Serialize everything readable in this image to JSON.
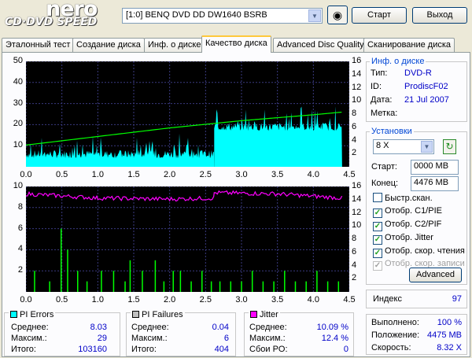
{
  "header": {
    "logo_top": "nero",
    "logo_bottom": "CD·DVD SPEED",
    "drive": "[1:0]   BENQ DVD DD DW1640 BSRB",
    "start_label": "Старт",
    "exit_label": "Выход"
  },
  "tabs": [
    {
      "label": "Эталонный тест"
    },
    {
      "label": "Создание диска"
    },
    {
      "label": "Инф. о диске"
    },
    {
      "label": "Качество диска",
      "active": true
    },
    {
      "label": "Advanced Disc Quality"
    },
    {
      "label": "Сканирование диска"
    }
  ],
  "disc_info": {
    "title": "Инф. о диске",
    "type_label": "Тип:",
    "type_value": "DVD-R",
    "id_label": "ID:",
    "id_value": "ProdiscF02",
    "date_label": "Дата:",
    "date_value": "21 Jul 2007",
    "mark_label": "Метка:",
    "mark_value": ""
  },
  "settings": {
    "title": "Установки",
    "speed": "8 X",
    "start_label": "Старт:",
    "start_value": "0000 MB",
    "end_label": "Конец:",
    "end_value": "4476 MB",
    "checkboxes": [
      {
        "label": "Быстр.скан.",
        "checked": false,
        "disabled": false
      },
      {
        "label": "Отобр. C1/PIE",
        "checked": true,
        "disabled": false
      },
      {
        "label": "Отобр. C2/PIF",
        "checked": true,
        "disabled": false
      },
      {
        "label": "Отобр. Jitter",
        "checked": true,
        "disabled": false
      },
      {
        "label": "Отобр. скор. чтения",
        "checked": true,
        "disabled": false
      },
      {
        "label": "Отобр. скор. записи",
        "checked": true,
        "disabled": true
      }
    ],
    "advanced_label": "Advanced"
  },
  "index": {
    "label": "Индекс",
    "value": "97"
  },
  "progress": {
    "done_label": "Выполнено:",
    "done_value": "100 %",
    "pos_label": "Положение:",
    "pos_value": "4475 MB",
    "speed_label": "Скорость:",
    "speed_value": "8.32 X"
  },
  "stats": {
    "pi_errors": {
      "title": "PI Errors",
      "color": "#00ffff",
      "avg_label": "Среднее:",
      "avg": "8.03",
      "max_label": "Максим.:",
      "max": "29",
      "total_label": "Итого:",
      "total": "103160"
    },
    "pi_failures": {
      "title": "PI Failures",
      "color": "#c0c0c0",
      "avg_label": "Среднее:",
      "avg": "0.04",
      "max_label": "Максим.:",
      "max": "6",
      "total_label": "Итого:",
      "total": "404"
    },
    "jitter": {
      "title": "Jitter",
      "color": "#ff00ff",
      "avg_label": "Среднее:",
      "avg": "10.09 %",
      "max_label": "Максим.:",
      "max": "12.4 %",
      "po_label": "Сбои PO:",
      "po": "0"
    }
  },
  "chart_data": [
    {
      "type": "area",
      "x_ticks": [
        "0.0",
        "0.5",
        "1.0",
        "1.5",
        "2.0",
        "2.5",
        "3.0",
        "3.5",
        "4.0",
        "4.5"
      ],
      "y_left_ticks": [
        "50",
        "40",
        "30",
        "20",
        "10"
      ],
      "y_right_ticks": [
        "16",
        "14",
        "12",
        "10",
        "8",
        "6",
        "4",
        "2"
      ],
      "xlim": [
        0,
        4.5
      ],
      "ylim_left": [
        0,
        50
      ],
      "ylim_right": [
        0,
        16
      ],
      "series": [
        {
          "color": "#00ffff",
          "segments": [
            {
              "x0": 0.0,
              "x1": 2.62,
              "base": 4,
              "spikes": 9
            },
            {
              "x0": 2.62,
              "x1": 4.4,
              "base": 17,
              "spikes": 10
            }
          ]
        },
        {
          "color": "#00ff00",
          "line": [
            [
              0.0,
              3.3
            ],
            [
              1.0,
              4.6
            ],
            [
              2.0,
              5.9
            ],
            [
              3.0,
              7.0
            ],
            [
              4.0,
              7.9
            ],
            [
              4.4,
              8.3
            ]
          ]
        }
      ]
    },
    {
      "type": "bar",
      "x_ticks": [
        "0.0",
        "0.5",
        "1.0",
        "1.5",
        "2.0",
        "2.5",
        "3.0",
        "3.5",
        "4.0",
        "4.5"
      ],
      "y_left_ticks": [
        "10",
        "8",
        "6",
        "4",
        "2"
      ],
      "y_right_ticks": [
        "16",
        "14",
        "12",
        "10",
        "8",
        "6",
        "4",
        "2"
      ],
      "xlim": [
        0,
        4.5
      ],
      "ylim_left": [
        0,
        10
      ],
      "ylim_right": [
        0,
        16
      ],
      "series": [
        {
          "color": "#ff00ff",
          "line": [
            [
              0.0,
              9.3
            ],
            [
              1.0,
              8.9
            ],
            [
              2.0,
              8.8
            ],
            [
              2.62,
              8.9
            ],
            [
              2.62,
              9.4
            ],
            [
              3.5,
              9.3
            ],
            [
              4.4,
              8.9
            ]
          ]
        },
        {
          "color": "#00ff00",
          "bars": [
            [
              0.12,
              2
            ],
            [
              0.33,
              1
            ],
            [
              0.49,
              6
            ],
            [
              0.58,
              4
            ],
            [
              0.72,
              2
            ],
            [
              0.85,
              1
            ],
            [
              1.05,
              2
            ],
            [
              1.22,
              2
            ],
            [
              1.38,
              1
            ],
            [
              1.45,
              3
            ],
            [
              1.62,
              2
            ],
            [
              1.8,
              3
            ],
            [
              1.92,
              1
            ],
            [
              2.05,
              2
            ],
            [
              2.15,
              2
            ],
            [
              2.3,
              1
            ],
            [
              2.45,
              2
            ],
            [
              2.58,
              1
            ],
            [
              2.7,
              1
            ],
            [
              2.85,
              1
            ],
            [
              3.0,
              1
            ],
            [
              3.15,
              2
            ],
            [
              3.3,
              1
            ],
            [
              3.45,
              1
            ],
            [
              3.6,
              2
            ],
            [
              3.75,
              1
            ],
            [
              3.9,
              1
            ],
            [
              4.05,
              2
            ],
            [
              4.2,
              1
            ],
            [
              4.35,
              1
            ]
          ]
        }
      ]
    }
  ]
}
